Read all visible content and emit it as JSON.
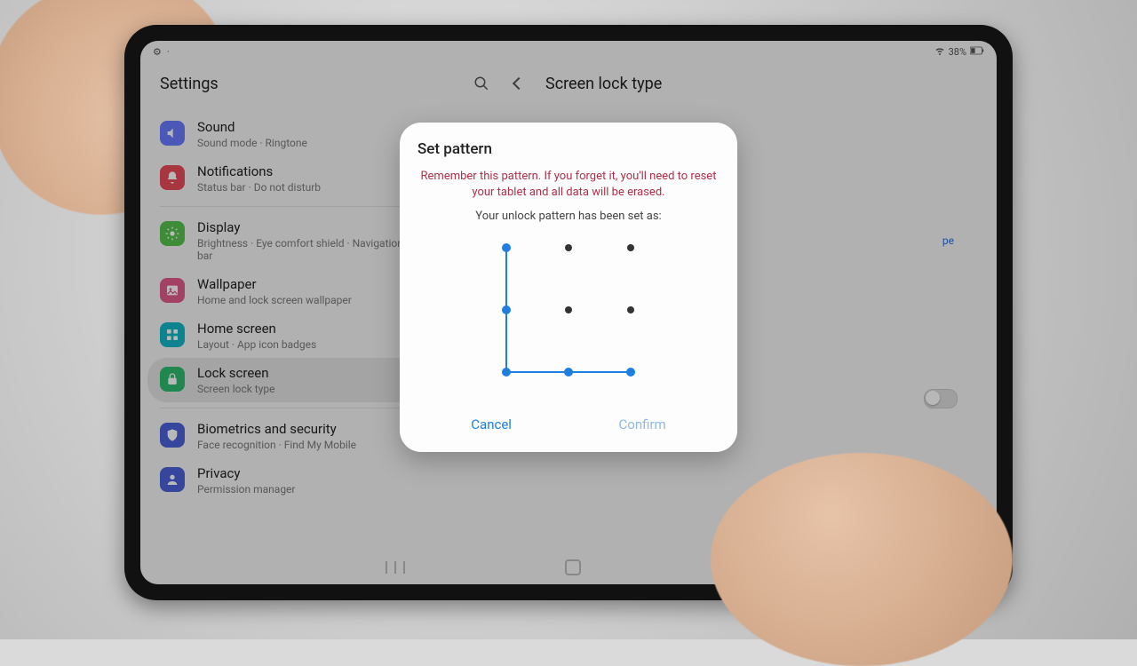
{
  "statusbar": {
    "battery_text": "38%"
  },
  "header": {
    "settings_label": "Settings",
    "page_title": "Screen lock type"
  },
  "sidebar": {
    "items": [
      {
        "icon": "sound",
        "color": "#6a7bff",
        "title": "Sound",
        "sub": "Sound mode  ·  Ringtone"
      },
      {
        "icon": "bell",
        "color": "#e84b5a",
        "title": "Notifications",
        "sub": "Status bar  ·  Do not disturb"
      },
      {
        "divider": true
      },
      {
        "icon": "sun",
        "color": "#57c24e",
        "title": "Display",
        "sub": "Brightness  ·  Eye comfort shield  ·  Navigation bar"
      },
      {
        "icon": "image",
        "color": "#e05a8a",
        "title": "Wallpaper",
        "sub": "Home and lock screen wallpaper"
      },
      {
        "icon": "grid",
        "color": "#13b6c8",
        "title": "Home screen",
        "sub": "Layout  ·  App icon badges"
      },
      {
        "icon": "lock",
        "color": "#2dbd6e",
        "title": "Lock screen",
        "sub": "Screen lock type",
        "selected": true
      },
      {
        "divider": true
      },
      {
        "icon": "shield",
        "color": "#4a62d8",
        "title": "Biometrics and security",
        "sub": "Face recognition  ·  Find My Mobile"
      },
      {
        "icon": "privacy",
        "color": "#4a62d8",
        "title": "Privacy",
        "sub": "Permission manager"
      }
    ]
  },
  "right_pane": {
    "hint_fragment": "pe"
  },
  "dialog": {
    "title": "Set pattern",
    "warning": "Remember this pattern. If you forget it, you'll need to reset your tablet and all data will be erased.",
    "message": "Your unlock pattern has been set as:",
    "cancel_label": "Cancel",
    "confirm_label": "Confirm",
    "pattern_nodes": [
      0,
      3,
      6,
      7,
      8
    ]
  },
  "colors": {
    "accent": "#1e7fe0",
    "warn": "#b0304b"
  }
}
